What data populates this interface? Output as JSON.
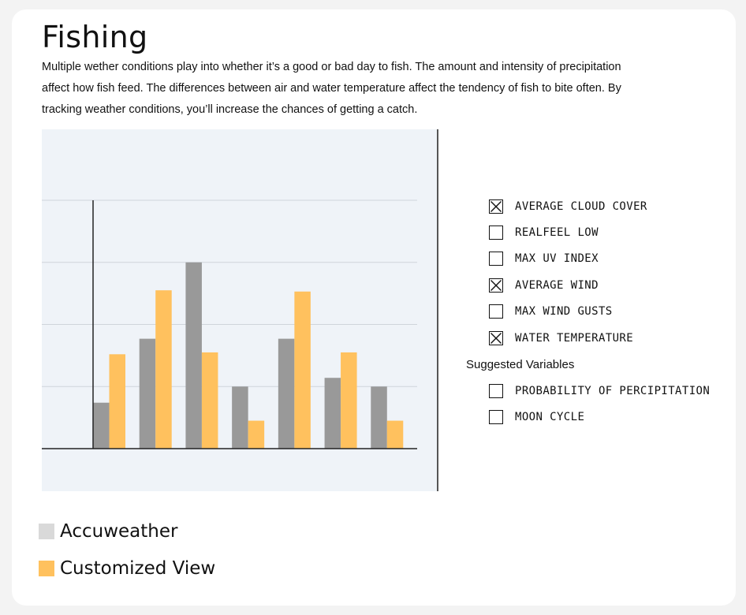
{
  "page": {
    "title": "Fishing",
    "description": "Multiple wether conditions play into whether it’s a good or bad day to fish. The amount and intensity of precipitation affect how fish feed. The differences between air and water temperature affect the tendency of fish to bite often. By tracking weather conditions, you’ll increase the chances of getting a catch."
  },
  "variables": [
    {
      "label": "AVERAGE CLOUD COVER",
      "checked": true
    },
    {
      "label": "REALFEEL LOW",
      "checked": false
    },
    {
      "label": "MAX UV INDEX",
      "checked": false
    },
    {
      "label": "AVERAGE WIND",
      "checked": true
    },
    {
      "label": "MAX WIND GUSTS",
      "checked": false
    },
    {
      "label": "WATER TEMPERATURE",
      "checked": true
    }
  ],
  "suggested": {
    "heading": "Suggested Variables",
    "items": [
      {
        "label": "PROBABILITY OF PERCIPITATION",
        "checked": false
      },
      {
        "label": "MOON CYCLE",
        "checked": false
      }
    ]
  },
  "legend": [
    {
      "label": "Accuweather",
      "color": "#d9d9d9"
    },
    {
      "label": "Customized View",
      "color": "#ffc15e"
    }
  ],
  "chart_data": {
    "type": "bar",
    "title": "",
    "xlabel": "",
    "ylabel": "",
    "categories": [
      "",
      "",
      "",
      "",
      "",
      "",
      ""
    ],
    "ylim": [
      0,
      4
    ],
    "grid": true,
    "series": [
      {
        "name": "Accuweather",
        "color": "#999999",
        "values": [
          0.74,
          1.77,
          3.0,
          1.0,
          1.77,
          1.14,
          1.0
        ]
      },
      {
        "name": "Customized View",
        "color": "#ffc15e",
        "values": [
          1.52,
          2.55,
          1.55,
          0.45,
          2.53,
          1.55,
          0.45
        ]
      }
    ]
  }
}
